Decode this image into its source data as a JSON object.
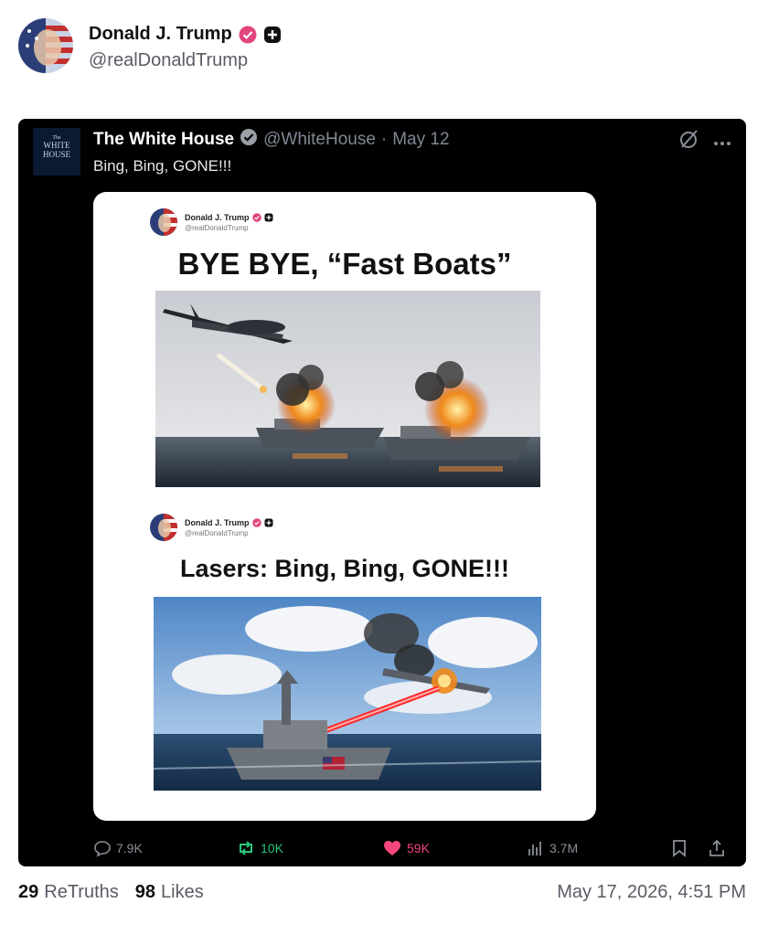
{
  "post": {
    "author_name": "Donald J. Trump",
    "author_handle": "@realDonaldTrump"
  },
  "embed": {
    "author_name": "The White House",
    "author_handle": "@WhiteHouse",
    "separator": "·",
    "date": "May 12",
    "text": "Bing, Bing, GONE!!!",
    "logo_lines": [
      "The",
      "WHITE",
      "HOUSE"
    ],
    "media": {
      "post1": {
        "name": "Donald J. Trump",
        "handle": "@realDonaldTrump",
        "headline": "BYE BYE, “Fast Boats”"
      },
      "post2": {
        "name": "Donald J. Trump",
        "handle": "@realDonaldTrump",
        "headline": "Lasers: Bing, Bing, GONE!!!"
      }
    },
    "actions": {
      "replies": "7.9K",
      "reposts": "10K",
      "likes": "59K",
      "views": "3.7M"
    }
  },
  "footer": {
    "retruths_count": "29",
    "retruths_label": "ReTruths",
    "likes_count": "98",
    "likes_label": "Likes",
    "timestamp": "May 17, 2026, 4:51 PM"
  },
  "colors": {
    "verified_badge": "#e3457e",
    "repost_green": "#27c77a",
    "like_pink": "#f5467a",
    "embed_bg": "#000000"
  },
  "icons": [
    "verified-badge-icon",
    "plus-badge-icon",
    "x-logo-icon",
    "more-icon",
    "reply-icon",
    "repost-icon",
    "heart-icon",
    "views-icon",
    "bookmark-icon",
    "share-icon"
  ]
}
